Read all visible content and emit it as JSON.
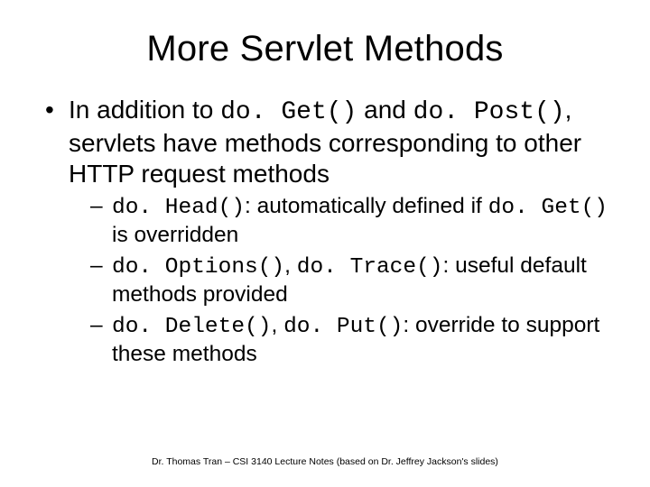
{
  "title": "More Servlet Methods",
  "bullet1": {
    "pre": "In addition to ",
    "m1": "do. Get()",
    "mid1": " and ",
    "m2": "do. Post()",
    "post": ", servlets have methods corresponding to other HTTP request methods"
  },
  "sub1": {
    "m1": "do. Head()",
    "t1": ": automatically defined if ",
    "m2": "do. Get()",
    "t2": " is overridden"
  },
  "sub2": {
    "m1": "do. Options()",
    "sep": ", ",
    "m2": "do. Trace()",
    "t": ": useful default methods provided"
  },
  "sub3": {
    "m1": "do. Delete()",
    "sep": ", ",
    "m2": "do. Put()",
    "t": ": override to support these methods"
  },
  "footer": "Dr. Thomas Tran – CSI 3140 Lecture Notes (based on Dr. Jeffrey Jackson's slides)"
}
